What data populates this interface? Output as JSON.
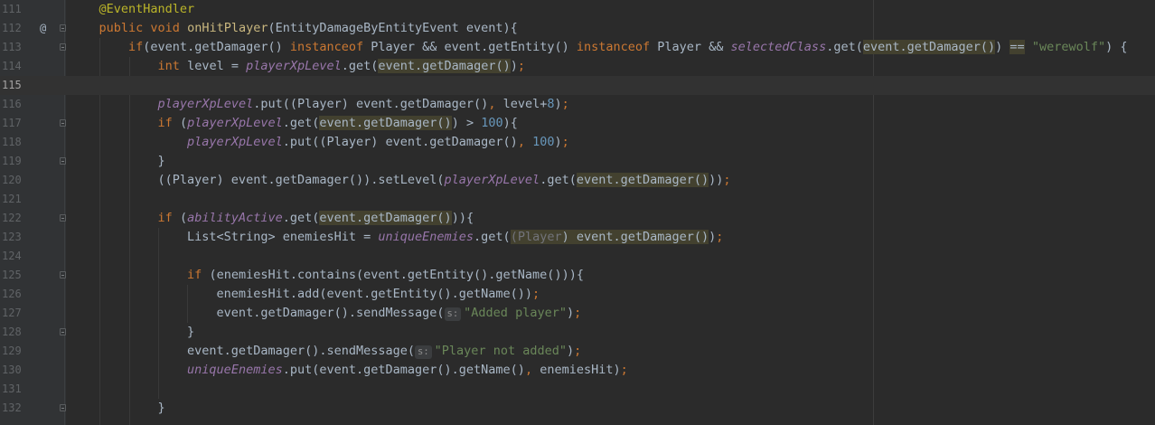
{
  "editor": {
    "current_line": 115,
    "colors": {
      "background": "#2b2b2b",
      "keyword": "#cc7832",
      "field": "#9876aa",
      "string": "#6a8759",
      "number": "#6897bb",
      "annotation": "#bbb529"
    },
    "lines": [
      {
        "n": "111",
        "tokens": [
          [
            "pl",
            "    "
          ],
          [
            "ann",
            "@EventHandler"
          ]
        ]
      },
      {
        "n": "112",
        "marker": "@",
        "fold": true,
        "tokens": [
          [
            "pl",
            "    "
          ],
          [
            "kw",
            "public void "
          ],
          [
            "fn",
            "onHitPlayer"
          ],
          [
            "pl",
            "(EntityDamageByEntityEvent event){"
          ]
        ]
      },
      {
        "n": "113",
        "fold": true,
        "tokens": [
          [
            "pl",
            "        "
          ],
          [
            "kw",
            "if"
          ],
          [
            "pl",
            "(event.getDamager() "
          ],
          [
            "kw",
            "instanceof "
          ],
          [
            "pl",
            "Player && event.getEntity() "
          ],
          [
            "kw",
            "instanceof "
          ],
          [
            "pl",
            "Player && "
          ],
          [
            "fld",
            "selectedClass"
          ],
          [
            "pl",
            ".get("
          ],
          [
            "pl hl",
            "event.getDamager()"
          ],
          [
            "pl",
            ") "
          ],
          [
            "pl hl",
            "=="
          ],
          [
            "pl",
            " "
          ],
          [
            "str",
            "\"werewolf\""
          ],
          [
            "pl",
            ") {"
          ]
        ]
      },
      {
        "n": "114",
        "tokens": [
          [
            "pl",
            "            "
          ],
          [
            "kw",
            "int "
          ],
          [
            "pl",
            "level = "
          ],
          [
            "fld",
            "playerXpLevel"
          ],
          [
            "pl",
            ".get("
          ],
          [
            "pl hl",
            "event.getDamager()"
          ],
          [
            "pl",
            ")"
          ],
          [
            "kw",
            ";"
          ]
        ]
      },
      {
        "n": "115",
        "tokens": []
      },
      {
        "n": "116",
        "tokens": [
          [
            "pl",
            "            "
          ],
          [
            "fld",
            "playerXpLevel"
          ],
          [
            "pl",
            ".put((Player) event.getDamager()"
          ],
          [
            "kw",
            ", "
          ],
          [
            "pl",
            "level+"
          ],
          [
            "num",
            "8"
          ],
          [
            "pl",
            ")"
          ],
          [
            "kw",
            ";"
          ]
        ]
      },
      {
        "n": "117",
        "fold": true,
        "tokens": [
          [
            "pl",
            "            "
          ],
          [
            "kw",
            "if "
          ],
          [
            "pl",
            "("
          ],
          [
            "fld",
            "playerXpLevel"
          ],
          [
            "pl",
            ".get("
          ],
          [
            "pl hl",
            "event.getDamager()"
          ],
          [
            "pl",
            ") > "
          ],
          [
            "num",
            "100"
          ],
          [
            "pl",
            "){"
          ]
        ]
      },
      {
        "n": "118",
        "tokens": [
          [
            "pl",
            "                "
          ],
          [
            "fld",
            "playerXpLevel"
          ],
          [
            "pl",
            ".put((Player) event.getDamager()"
          ],
          [
            "kw",
            ", "
          ],
          [
            "num",
            "100"
          ],
          [
            "pl",
            ")"
          ],
          [
            "kw",
            ";"
          ]
        ]
      },
      {
        "n": "119",
        "fold": true,
        "tokens": [
          [
            "pl",
            "            }"
          ]
        ]
      },
      {
        "n": "120",
        "tokens": [
          [
            "pl",
            "            ((Player) event.getDamager()).setLevel("
          ],
          [
            "fld",
            "playerXpLevel"
          ],
          [
            "pl",
            ".get("
          ],
          [
            "pl hl",
            "event.getDamager()"
          ],
          [
            "pl",
            "))"
          ],
          [
            "kw",
            ";"
          ]
        ]
      },
      {
        "n": "121",
        "tokens": []
      },
      {
        "n": "122",
        "fold": true,
        "tokens": [
          [
            "pl",
            "            "
          ],
          [
            "kw",
            "if "
          ],
          [
            "pl",
            "("
          ],
          [
            "fld",
            "abilityActive"
          ],
          [
            "pl",
            ".get("
          ],
          [
            "pl hl",
            "event.getDamager()"
          ],
          [
            "pl",
            ")){"
          ]
        ]
      },
      {
        "n": "123",
        "tokens": [
          [
            "pl",
            "                List<String> enemiesHit = "
          ],
          [
            "fld",
            "uniqueEnemies"
          ],
          [
            "pl",
            ".get("
          ],
          [
            "dim hl",
            "(Player"
          ],
          [
            "pl hl",
            ") event.getDamager()"
          ],
          [
            "pl",
            ")"
          ],
          [
            "kw",
            ";"
          ]
        ]
      },
      {
        "n": "124",
        "tokens": []
      },
      {
        "n": "125",
        "fold": true,
        "tokens": [
          [
            "pl",
            "                "
          ],
          [
            "kw",
            "if "
          ],
          [
            "pl",
            "(enemiesHit.contains(event.getEntity().getName())){"
          ]
        ]
      },
      {
        "n": "126",
        "tokens": [
          [
            "pl",
            "                    enemiesHit.add(event.getEntity().getName())"
          ],
          [
            "kw",
            ";"
          ]
        ]
      },
      {
        "n": "127",
        "tokens": [
          [
            "pl",
            "                    event.getDamager().sendMessage("
          ],
          [
            "hint",
            "s:"
          ],
          [
            "str",
            "\"Added player\""
          ],
          [
            "pl",
            ")"
          ],
          [
            "kw",
            ";"
          ]
        ]
      },
      {
        "n": "128",
        "fold": true,
        "tokens": [
          [
            "pl",
            "                }"
          ]
        ]
      },
      {
        "n": "129",
        "tokens": [
          [
            "pl",
            "                event.getDamager().sendMessage("
          ],
          [
            "hint",
            "s:"
          ],
          [
            "str",
            "\"Player not added\""
          ],
          [
            "pl",
            ")"
          ],
          [
            "kw",
            ";"
          ]
        ]
      },
      {
        "n": "130",
        "tokens": [
          [
            "pl",
            "                "
          ],
          [
            "fld",
            "uniqueEnemies"
          ],
          [
            "pl",
            ".put(event.getDamager().getName()"
          ],
          [
            "kw",
            ", "
          ],
          [
            "pl",
            "enemiesHit)"
          ],
          [
            "kw",
            ";"
          ]
        ]
      },
      {
        "n": "131",
        "tokens": []
      },
      {
        "n": "132",
        "fold": true,
        "tokens": [
          [
            "pl",
            "            }"
          ]
        ]
      }
    ]
  }
}
